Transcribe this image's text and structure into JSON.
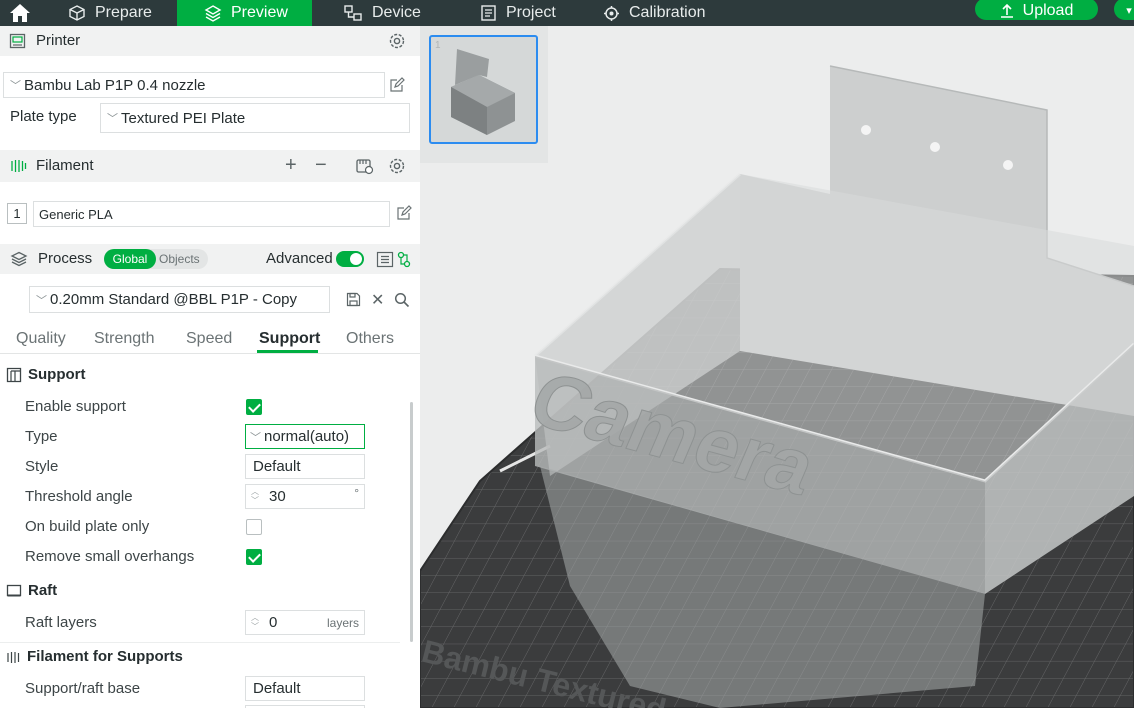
{
  "topbar": {
    "tabs": [
      {
        "label": "Prepare"
      },
      {
        "label": "Preview"
      },
      {
        "label": "Device"
      },
      {
        "label": "Project"
      },
      {
        "label": "Calibration"
      }
    ],
    "upload_label": "Upload",
    "active_tab": "Preview"
  },
  "printer": {
    "title": "Printer",
    "selected": "Bambu Lab P1P 0.4 nozzle",
    "plate_type_label": "Plate type",
    "plate_type_value": "Textured PEI Plate"
  },
  "filament": {
    "title": "Filament",
    "slots": [
      {
        "index": "1",
        "name": "Generic PLA"
      }
    ]
  },
  "process": {
    "title": "Process",
    "toggle_global": "Global",
    "toggle_objects": "Objects",
    "advanced_label": "Advanced",
    "advanced_on": true,
    "preset": "0.20mm Standard @BBL P1P - Copy",
    "tabs": [
      "Quality",
      "Strength",
      "Speed",
      "Support",
      "Others"
    ],
    "active_tab": "Support"
  },
  "support": {
    "title": "Support",
    "enable_support": {
      "label": "Enable support",
      "checked": true
    },
    "type": {
      "label": "Type",
      "value": "normal(auto)"
    },
    "style": {
      "label": "Style",
      "value": "Default"
    },
    "threshold_angle": {
      "label": "Threshold angle",
      "value": "30",
      "unit": "°"
    },
    "on_build_plate_only": {
      "label": "On build plate only",
      "checked": false
    },
    "remove_small_overhangs": {
      "label": "Remove small overhangs",
      "checked": true
    }
  },
  "raft": {
    "title": "Raft",
    "raft_layers": {
      "label": "Raft layers",
      "value": "0",
      "unit": "layers"
    }
  },
  "filament_for_supports": {
    "title": "Filament for Supports",
    "support_raft_base": {
      "label": "Support/raft base",
      "value": "Default"
    }
  },
  "viewport": {
    "plate_thumbnail_number": "1",
    "model_text": "Camera",
    "bed_text": "Bambu Textured",
    "colors": {
      "accent": "#00ae42",
      "selection": "#2c8cf0",
      "bed": "#3a3b3c"
    }
  }
}
